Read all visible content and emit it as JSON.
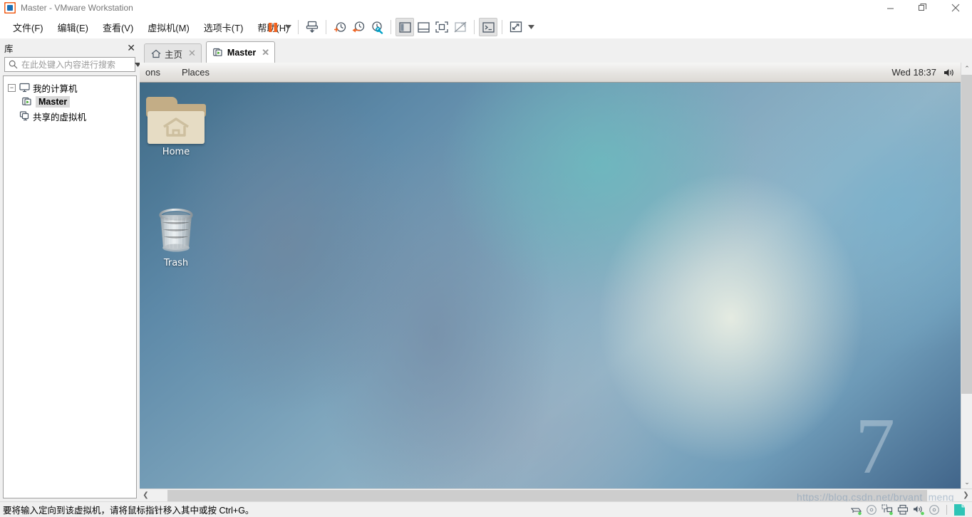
{
  "window": {
    "title": "Master - VMware Workstation",
    "app_icon": "vmware-logo-icon",
    "minimize": "—",
    "restore": "❐",
    "close": "✕"
  },
  "menubar": {
    "items": [
      {
        "label": "文件(F)",
        "name": "menu-file"
      },
      {
        "label": "编辑(E)",
        "name": "menu-edit"
      },
      {
        "label": "查看(V)",
        "name": "menu-view"
      },
      {
        "label": "虚拟机(M)",
        "name": "menu-vm"
      },
      {
        "label": "选项卡(T)",
        "name": "menu-tabs"
      },
      {
        "label": "帮助(H)",
        "name": "menu-help"
      }
    ]
  },
  "toolbar": {
    "buttons": [
      {
        "name": "suspend-button",
        "icon": "pause-icon"
      },
      {
        "name": "power-dropdown",
        "icon": "chevron-down-icon"
      },
      {
        "name": "snapshot-button",
        "icon": "snapshot-icon"
      },
      {
        "name": "take-snapshot-button",
        "icon": "clock-plus-icon"
      },
      {
        "name": "revert-snapshot-button",
        "icon": "clock-back-icon"
      },
      {
        "name": "snapshot-manager-button",
        "icon": "clock-wrench-icon"
      },
      {
        "name": "show-library-button",
        "icon": "sidebar-panel-icon"
      },
      {
        "name": "show-thumbnails-button",
        "icon": "thumbnail-bar-icon"
      },
      {
        "name": "fullscreen-button",
        "icon": "fullscreen-icon"
      },
      {
        "name": "unity-button",
        "icon": "unity-icon"
      },
      {
        "name": "console-button",
        "icon": "terminal-icon"
      },
      {
        "name": "stretch-button",
        "icon": "stretch-arrows-icon"
      },
      {
        "name": "stretch-dropdown",
        "icon": "chevron-down-icon"
      }
    ]
  },
  "sidebar": {
    "title": "库",
    "close_label": "✕",
    "search": {
      "placeholder": "在此处键入内容进行搜索",
      "value": "",
      "icon": "search-icon",
      "dropdown_icon": "chevron-down-icon"
    },
    "tree": {
      "expander": "−",
      "root": {
        "label": "我的计算机",
        "icon": "monitor-icon"
      },
      "children": [
        {
          "label": "Master",
          "icon": "vm-running-icon",
          "selected": true
        }
      ],
      "shared": {
        "label": "共享的虚拟机",
        "icon": "shared-vm-icon"
      }
    }
  },
  "tabs": [
    {
      "label": "主页",
      "icon": "home-icon",
      "close": "✕",
      "active": false
    },
    {
      "label": "Master",
      "icon": "vm-running-icon",
      "close": "✕",
      "active": true
    }
  ],
  "guest": {
    "panel": {
      "applications_label": "ons",
      "places_label": "Places",
      "clock": "Wed 18:37",
      "volume_icon": "speaker-icon"
    },
    "desktop_icons": [
      {
        "label": "Home",
        "icon": "home-folder-icon"
      },
      {
        "label": "Trash",
        "icon": "trash-can-icon"
      }
    ],
    "wallpaper_watermark": "7"
  },
  "scrollbars": {
    "vertical": {
      "up": "⌃",
      "down": "⌄"
    },
    "horizontal": {
      "left": "❮",
      "right": "❯"
    }
  },
  "statusbar": {
    "message": "要将输入定向到该虚拟机，请将鼠标指针移入其中或按 Ctrl+G。",
    "devices": [
      {
        "name": "hard-disk-icon"
      },
      {
        "name": "cd-dvd-icon"
      },
      {
        "name": "network-adapter-icon"
      },
      {
        "name": "printer-icon"
      },
      {
        "name": "sound-card-icon"
      },
      {
        "name": "optical-drive-icon"
      },
      {
        "name": "usb-device-icon"
      }
    ]
  },
  "watermark": {
    "text": "https://blog.csdn.net/brvant_meng"
  },
  "colors": {
    "accent_orange": "#f06321",
    "vm_green": "#36a41d",
    "tab_active_bg": "#ffffff",
    "chrome_bg": "#f0f0f0",
    "status_led": "#5fd35f"
  }
}
